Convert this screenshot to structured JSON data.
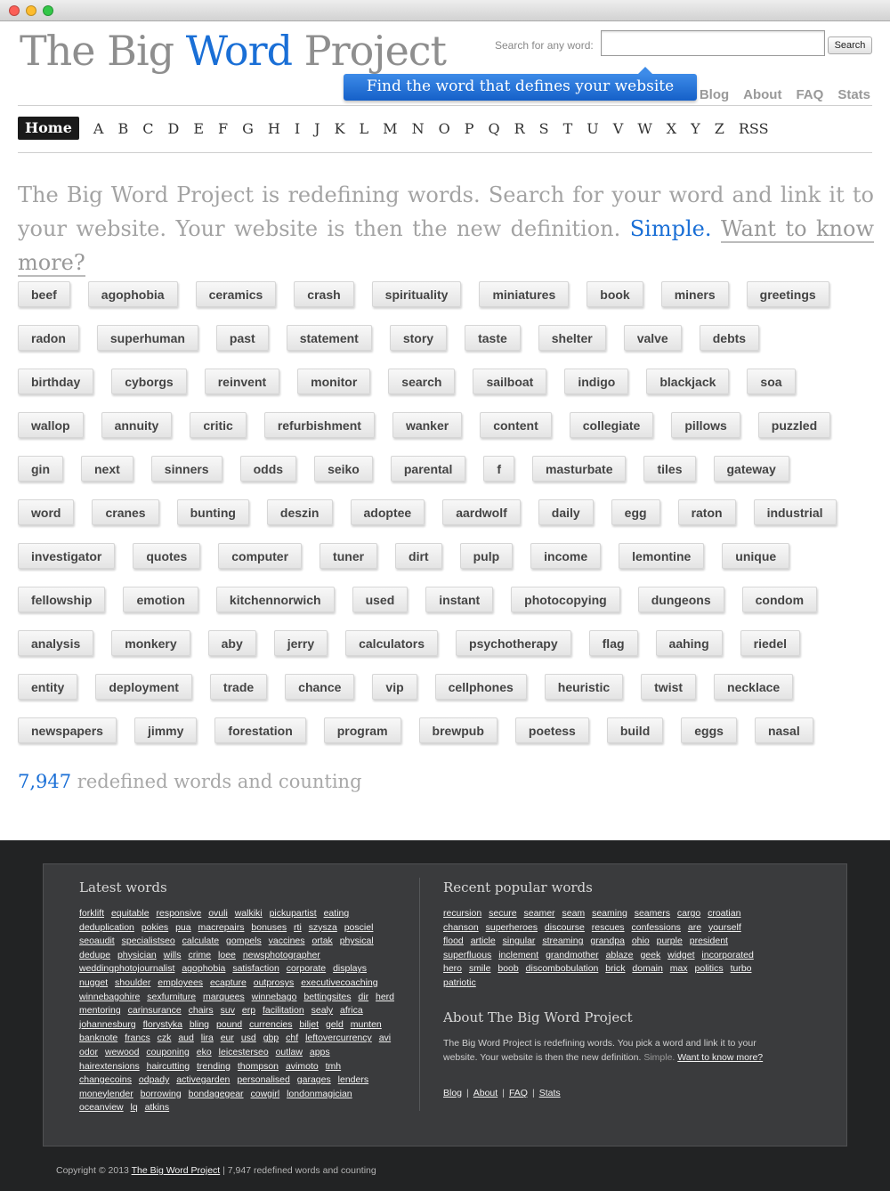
{
  "header": {
    "logo_part1": "The Big ",
    "logo_part2": "Word",
    "logo_part3": " Project",
    "search_label": "Search for any word:",
    "search_value": "",
    "search_button": "Search",
    "banner": "Find the word that defines your website",
    "links": [
      "Blog",
      "About",
      "FAQ",
      "Stats"
    ]
  },
  "nav": {
    "home": "Home",
    "letters": [
      "A",
      "B",
      "C",
      "D",
      "E",
      "F",
      "G",
      "H",
      "I",
      "J",
      "K",
      "L",
      "M",
      "N",
      "O",
      "P",
      "Q",
      "R",
      "S",
      "T",
      "U",
      "V",
      "W",
      "X",
      "Y",
      "Z"
    ],
    "rss": "RSS"
  },
  "intro": {
    "text": "The Big Word Project is redefining words. Search for your word and link it to your website. Your website is then the new definition. ",
    "simple": "Simple.",
    "more": "Want to know more?"
  },
  "words": [
    [
      "beef",
      "agophobia",
      "ceramics",
      "crash",
      "spirituality",
      "miniatures",
      "book",
      "miners",
      "greetings"
    ],
    [
      "radon",
      "superhuman",
      "past",
      "statement",
      "story",
      "taste",
      "shelter",
      "valve",
      "debts"
    ],
    [
      "birthday",
      "cyborgs",
      "reinvent",
      "monitor",
      "search",
      "sailboat",
      "indigo",
      "blackjack",
      "soa"
    ],
    [
      "wallop",
      "annuity",
      "critic",
      "refurbishment",
      "wanker",
      "content",
      "collegiate",
      "pillows",
      "puzzled"
    ],
    [
      "gin",
      "next",
      "sinners",
      "odds",
      "seiko",
      "parental",
      "f",
      "masturbate",
      "tiles",
      "gateway"
    ],
    [
      "word",
      "cranes",
      "bunting",
      "deszin",
      "adoptee",
      "aardwolf",
      "daily",
      "egg",
      "raton",
      "industrial"
    ],
    [
      "investigator",
      "quotes",
      "computer",
      "tuner",
      "dirt",
      "pulp",
      "income",
      "lemontine",
      "unique"
    ],
    [
      "fellowship",
      "emotion",
      "kitchennorwich",
      "used",
      "instant",
      "photocopying",
      "dungeons",
      "condom"
    ],
    [
      "analysis",
      "monkery",
      "aby",
      "jerry",
      "calculators",
      "psychotherapy",
      "flag",
      "aahing",
      "riedel"
    ],
    [
      "entity",
      "deployment",
      "trade",
      "chance",
      "vip",
      "cellphones",
      "heuristic",
      "twist",
      "necklace"
    ],
    [
      "newspapers",
      "jimmy",
      "forestation",
      "program",
      "brewpub",
      "poetess",
      "build",
      "eggs",
      "nasal"
    ]
  ],
  "counter": {
    "number": "7,947",
    "text": " redefined words and counting"
  },
  "footer": {
    "latest_title": "Latest words",
    "latest_words": [
      "forklift",
      "equitable",
      "responsive",
      "ovuli",
      "walkiki",
      "pickupartist",
      "eating",
      "deduplication",
      "pokies",
      "pua",
      "macrepairs",
      "bonuses",
      "rti",
      "szysza",
      "posciel",
      "seoaudit",
      "specialistseo",
      "calculate",
      "gompels",
      "vaccines",
      "ortak",
      "physical",
      "dedupe",
      "physician",
      "wills",
      "crime",
      "loee",
      "newsphotographer",
      "weddingphotojournalist",
      "agophobia",
      "satisfaction",
      "corporate",
      "displays",
      "nugget",
      "shoulder",
      "employees",
      "ecapture",
      "outprosys",
      "executivecoaching",
      "winnebagohire",
      "sexfurniture",
      "marquees",
      "winnebago",
      "bettingsites",
      "dir",
      "herd",
      "mentoring",
      "carinsurance",
      "chairs",
      "suv",
      "erp",
      "facilitation",
      "sealy",
      "africa",
      "johannesburg",
      "florystyka",
      "bling",
      "pound",
      "currencies",
      "biljet",
      "geld",
      "munten",
      "banknote",
      "francs",
      "czk",
      "aud",
      "lira",
      "eur",
      "usd",
      "gbp",
      "chf",
      "leftovercurrency",
      "avi",
      "odor",
      "wewood",
      "couponing",
      "eko",
      "leicesterseo",
      "outlaw",
      "apps",
      "hairextensions",
      "haircutting",
      "trending",
      "thompson",
      "avimoto",
      "tmh",
      "changecoins",
      "odpady",
      "activegarden",
      "personalised",
      "garages",
      "lenders",
      "moneylender",
      "borrowing",
      "bondagegear",
      "cowgirl",
      "londonmagician",
      "oceanview",
      "lq",
      "atkins"
    ],
    "popular_title": "Recent popular words",
    "popular_words": [
      "recursion",
      "secure",
      "seamer",
      "seam",
      "seaming",
      "seamers",
      "cargo",
      "croatian",
      "chanson",
      "superheroes",
      "discourse",
      "rescues",
      "confessions",
      "are",
      "yourself",
      "flood",
      "article",
      "singular",
      "streaming",
      "grandpa",
      "ohio",
      "purple",
      "president",
      "superfluous",
      "inclement",
      "grandmother",
      "ablaze",
      "geek",
      "widget",
      "incorporated",
      "hero",
      "smile",
      "boob",
      "discombobulation",
      "brick",
      "domain",
      "max",
      "politics",
      "turbo",
      "patriotic"
    ],
    "about_title": "About The Big Word Project",
    "about_text": "The Big Word Project is redefining words. You pick a word and link it to your website. Your website is then the new definition. ",
    "about_simple": "Simple.",
    "about_link": "Want to know more?",
    "nav": [
      "Blog",
      "About",
      "FAQ",
      "Stats"
    ],
    "copyright_prefix": "Copyright © 2013 ",
    "copyright_link": "The Big Word Project",
    "copyright_suffix": " | 7,947 redefined words and counting"
  },
  "colors": {
    "accent": "#1a6fd6",
    "footer_bg": "#222324",
    "footer_box": "#3a3b3d"
  }
}
